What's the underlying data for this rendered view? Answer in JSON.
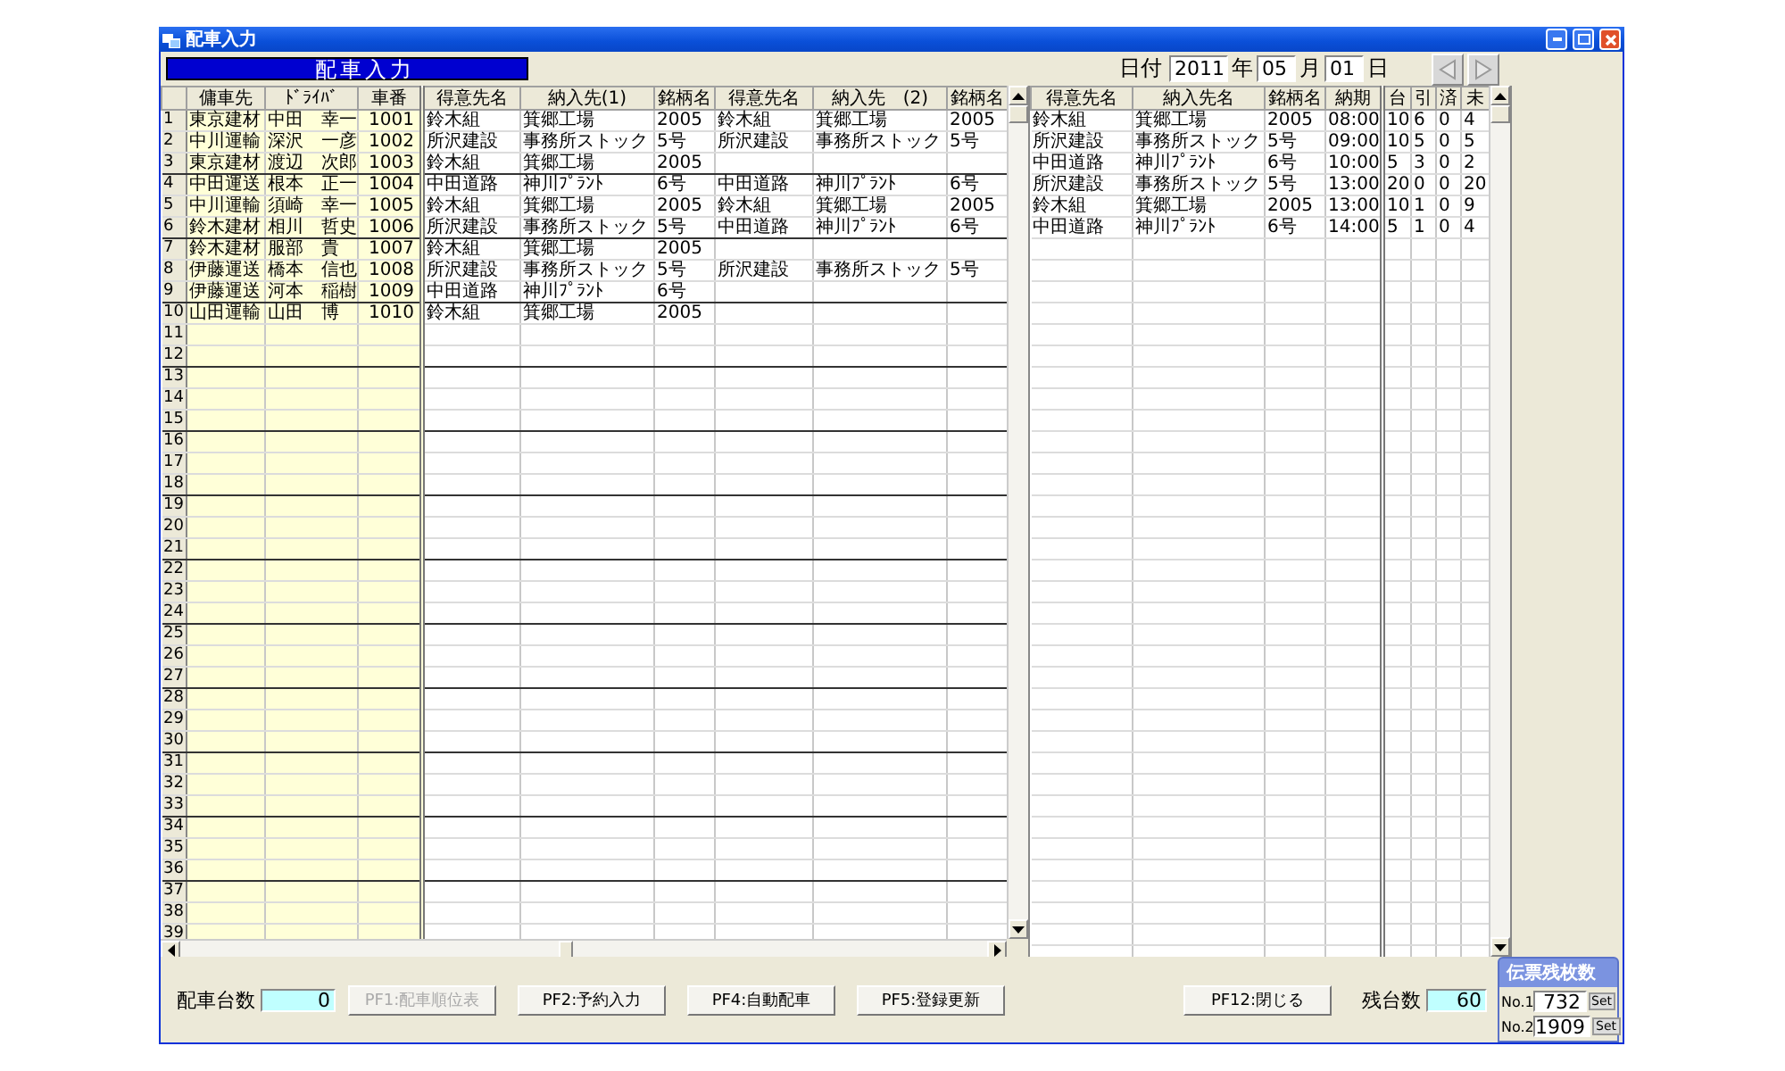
{
  "window": {
    "title": "配車入力"
  },
  "header": {
    "title": "配車入力",
    "date_label": "日付",
    "year": "2011",
    "year_unit": "年",
    "month": "05",
    "month_unit": "月",
    "day": "01",
    "day_unit": "日"
  },
  "left_grid": {
    "columns": [
      {
        "label": "傭車先",
        "highlighted": true
      },
      {
        "label": "ﾄﾞﾗｲﾊﾞ",
        "highlighted": true
      },
      {
        "label": "車番",
        "highlighted": true,
        "kind": "number"
      },
      {
        "label": "得意先名",
        "highlighted": false
      },
      {
        "label": "納入先(1)",
        "highlighted": false
      },
      {
        "label": "銘柄名",
        "highlighted": false
      },
      {
        "label": "得意先名",
        "highlighted": false
      },
      {
        "label": "納入先　(2)",
        "highlighted": false
      },
      {
        "label": "銘柄名",
        "highlighted": false
      }
    ],
    "rows": [
      {
        "num": "1",
        "cells": [
          "東京建材",
          "中田　幸一",
          "1001",
          "鈴木組",
          "箕郷工場",
          "2005",
          "鈴木組",
          "箕郷工場",
          "2005"
        ]
      },
      {
        "num": "2",
        "cells": [
          "中川運輸",
          "深沢　一彦",
          "1002",
          "所沢建設",
          "事務所ストック",
          "5号",
          "所沢建設",
          "事務所ストック",
          "5号"
        ]
      },
      {
        "num": "3",
        "cells": [
          "東京建材",
          "渡辺　次郎",
          "1003",
          "鈴木組",
          "箕郷工場",
          "2005"
        ]
      },
      {
        "num": "4",
        "cells": [
          "中田運送",
          "根本　正一",
          "1004",
          "中田道路",
          "神川ﾌﾟﾗﾝﾄ",
          "6号",
          "中田道路",
          "神川ﾌﾟﾗﾝﾄ",
          "6号"
        ]
      },
      {
        "num": "5",
        "cells": [
          "中川運輸",
          "須崎　幸一",
          "1005",
          "鈴木組",
          "箕郷工場",
          "2005",
          "鈴木組",
          "箕郷工場",
          "2005"
        ]
      },
      {
        "num": "6",
        "cells": [
          "鈴木建材",
          "相川　哲史",
          "1006",
          "所沢建設",
          "事務所ストック",
          "5号",
          "中田道路",
          "神川ﾌﾟﾗﾝﾄ",
          "6号"
        ]
      },
      {
        "num": "7",
        "cells": [
          "鈴木建材",
          "服部　貴",
          "1007",
          "鈴木組",
          "箕郷工場",
          "2005"
        ]
      },
      {
        "num": "8",
        "cells": [
          "伊藤運送",
          "橋本　信也",
          "1008",
          "所沢建設",
          "事務所ストック",
          "5号",
          "所沢建設",
          "事務所ストック",
          "5号"
        ]
      },
      {
        "num": "9",
        "cells": [
          "伊藤運送",
          "河本　稲樹",
          "1009",
          "中田道路",
          "神川ﾌﾟﾗﾝﾄ",
          "6号"
        ]
      },
      {
        "num": "10",
        "cells": [
          "山田運輸",
          "山田　博",
          "1010",
          "鈴木組",
          "箕郷工場",
          "2005"
        ]
      },
      {
        "num": "11"
      },
      {
        "num": "12"
      },
      {
        "num": "13"
      },
      {
        "num": "14"
      },
      {
        "num": "15"
      },
      {
        "num": "16"
      },
      {
        "num": "17"
      },
      {
        "num": "18"
      },
      {
        "num": "19"
      },
      {
        "num": "20"
      },
      {
        "num": "21"
      },
      {
        "num": "22"
      },
      {
        "num": "23"
      },
      {
        "num": "24"
      },
      {
        "num": "25"
      },
      {
        "num": "26"
      },
      {
        "num": "27"
      },
      {
        "num": "28"
      },
      {
        "num": "29"
      },
      {
        "num": "30"
      },
      {
        "num": "31"
      },
      {
        "num": "32"
      },
      {
        "num": "33"
      },
      {
        "num": "34"
      },
      {
        "num": "35"
      },
      {
        "num": "36"
      },
      {
        "num": "37"
      },
      {
        "num": "38"
      },
      {
        "num": "39"
      }
    ]
  },
  "right_grid": {
    "columns": [
      {
        "label": "得意先名"
      },
      {
        "label": "納入先名"
      },
      {
        "label": "銘柄名"
      },
      {
        "label": "納期"
      },
      {
        "label": "台"
      },
      {
        "label": "引"
      },
      {
        "label": "済"
      },
      {
        "label": "未"
      }
    ],
    "rows": [
      {
        "cells": [
          "鈴木組",
          "箕郷工場",
          "2005",
          "08:00",
          "10",
          "6",
          "0",
          "4"
        ]
      },
      {
        "cells": [
          "所沢建設",
          "事務所ストック",
          "5号",
          "09:00",
          "10",
          "5",
          "0",
          "5"
        ]
      },
      {
        "cells": [
          "中田道路",
          "神川ﾌﾟﾗﾝﾄ",
          "6号",
          "10:00",
          "5",
          "3",
          "0",
          "2"
        ]
      },
      {
        "cells": [
          "所沢建設",
          "事務所ストック",
          "5号",
          "13:00",
          "20",
          "0",
          "0",
          "20"
        ]
      },
      {
        "cells": [
          "鈴木組",
          "箕郷工場",
          "2005",
          "13:00",
          "10",
          "1",
          "0",
          "9"
        ]
      },
      {
        "cells": [
          "中田道路",
          "神川ﾌﾟﾗﾝﾄ",
          "6号",
          "14:00",
          "5",
          "1",
          "0",
          "4"
        ]
      }
    ]
  },
  "footer": {
    "count_label": "配車台数",
    "count_value": "0",
    "buttons": [
      {
        "label": "PF1:配車順位表",
        "disabled": true
      },
      {
        "label": "PF2:予約入力",
        "disabled": false
      },
      {
        "label": "PF4:自動配車",
        "disabled": false
      },
      {
        "label": "PF5:登録更新",
        "disabled": false
      },
      {
        "label": "PF12:閉じる",
        "disabled": false
      }
    ],
    "remaining_label": "残台数",
    "remaining_value": "60"
  },
  "slip_panel": {
    "title": "伝票残枚数",
    "rows": [
      {
        "label": "No.1",
        "value": "732",
        "button": "Set"
      },
      {
        "label": "No.2",
        "value": "1909",
        "button": "Set"
      }
    ]
  }
}
